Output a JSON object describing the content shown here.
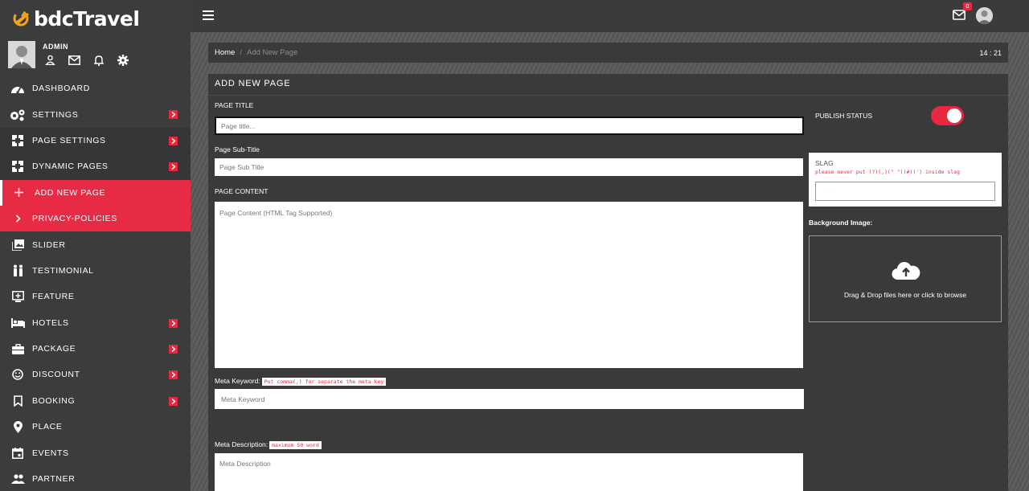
{
  "brand": {
    "name": "bdcTravel"
  },
  "user": {
    "name": "ADMIN"
  },
  "sidebar": {
    "items": [
      {
        "label": "DASHBOARD",
        "icon": "dashboard-icon"
      },
      {
        "label": "SETTINGS",
        "icon": "gears-icon",
        "has_arrow": true
      },
      {
        "label": "PAGE SETTINGS",
        "icon": "pages-icon",
        "has_arrow": true
      },
      {
        "label": "DYNAMIC PAGES",
        "icon": "pages-icon",
        "has_arrow": true
      },
      {
        "label": "ADD NEW PAGE",
        "icon": "plus-icon"
      },
      {
        "label": "PRIVACY-POLICIES",
        "icon": "chevron-right-icon"
      },
      {
        "label": "SLIDER",
        "icon": "images-icon"
      },
      {
        "label": "TESTIMONIAL",
        "icon": "people-icon"
      },
      {
        "label": "FEATURE",
        "icon": "feature-icon"
      },
      {
        "label": "HOTELS",
        "icon": "bed-icon",
        "has_arrow": true
      },
      {
        "label": "PACKAGE",
        "icon": "briefcase-icon",
        "has_arrow": true
      },
      {
        "label": "DISCOUNT",
        "icon": "smile-icon",
        "has_arrow": true
      },
      {
        "label": "BOOKING",
        "icon": "bookmark-icon",
        "has_arrow": true
      },
      {
        "label": "PLACE",
        "icon": "pin-icon"
      },
      {
        "label": "EVENTS",
        "icon": "calendar-icon"
      },
      {
        "label": "PARTNER",
        "icon": "group-icon"
      }
    ]
  },
  "topbar": {
    "mail_count": "0"
  },
  "breadcrumb": {
    "home": "Home",
    "separator": "/",
    "current": "Add New Page",
    "clock": "14 : 21"
  },
  "form": {
    "title": "ADD NEW PAGE",
    "page_title_label": "PAGE TITLE",
    "page_title_placeholder": "Page title...",
    "subtitle_label": "Page Sub-Title",
    "subtitle_placeholder": "Page Sub Title",
    "content_label": "PAGE CONTENT",
    "content_placeholder": "Page Content (HTML Tag Supported)",
    "meta_keyword_label": "Meta Keyword:",
    "meta_keyword_note": "Put comma(,) for separate the meta key",
    "meta_keyword_placeholder": "Meta Keyword",
    "meta_desc_label": "Meta Description:",
    "meta_desc_note": "maximum 50 word",
    "meta_desc_placeholder": "Meta Description",
    "publish_status_label": "PUBLISH STATUS",
    "publish_status_on": true,
    "slag_label": "SLAG",
    "slag_note": "please never put (?)(,)(\" \")(#)(') inside slag",
    "bg_image_label": "Background Image:",
    "dropzone_text": "Drag & Drop files here or click to browse"
  },
  "colors": {
    "accent": "#e8283f",
    "sidebar": "#3c3c3c",
    "panel": "#3a3a3a"
  }
}
